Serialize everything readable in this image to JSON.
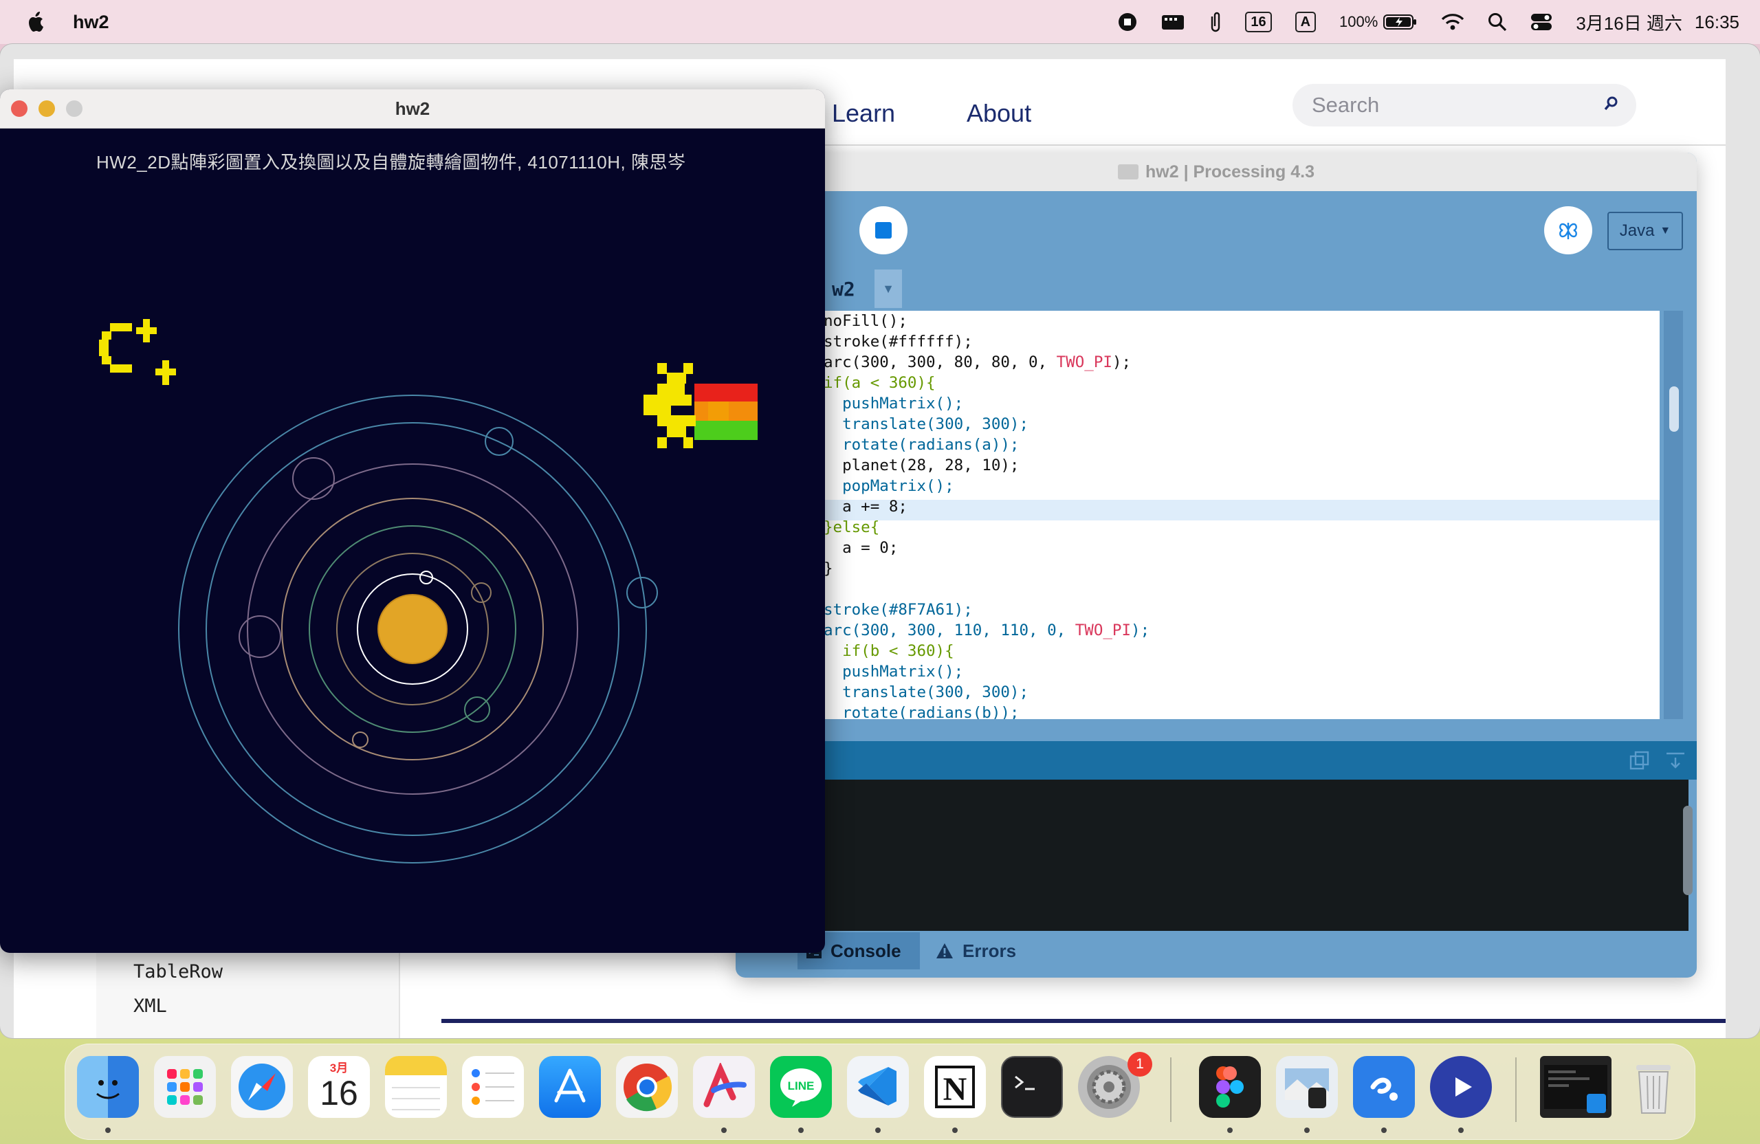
{
  "menubar": {
    "app_name": "hw2",
    "input_badge_16": "16",
    "input_badge_a": "A",
    "battery": "100%",
    "date": "3月16日 週六",
    "time": "16:35"
  },
  "browser": {
    "nav": {
      "learn": "Learn",
      "about": "About"
    },
    "search_placeholder": "Search",
    "reference_items": [
      "TableRow",
      "XML"
    ]
  },
  "ide": {
    "title": "hw2 | Processing 4.3",
    "mode": "Java",
    "tab": "w2",
    "code_lines": [
      "noFill();",
      "stroke(#ffffff);",
      "arc(300, 300, 80, 80, 0, TWO_PI);",
      "if(a < 360){",
      "  pushMatrix();",
      "  translate(300, 300);",
      "  rotate(radians(a));",
      "  planet(28, 28, 10);",
      "  popMatrix();",
      "  a += 8;",
      "}else{",
      "  a = 0;",
      "}",
      "",
      "stroke(#8F7A61);",
      "arc(300, 300, 110, 110, 0, TWO_PI);",
      "  if(b < 360){",
      "  pushMatrix();",
      "  translate(300, 300);",
      "  rotate(radians(b));"
    ],
    "console_tab": "Console",
    "errors_tab": "Errors"
  },
  "sketch": {
    "window_title": "hw2",
    "heading": "HW2_2D點陣彩圖置入及換圖以及自體旋轉繪圖物件, 41071110H, 陳思岑"
  },
  "dock": {
    "calendar_month": "3月",
    "calendar_day": "16",
    "settings_badge": "1",
    "apps": [
      "finder-icon",
      "launchpad-icon",
      "safari-icon",
      "calendar-icon",
      "notes-icon",
      "reminders-icon",
      "app-store-icon",
      "chrome-icon",
      "sketchbook-icon",
      "line-icon",
      "vscode-icon",
      "notion-icon",
      "terminal-icon",
      "system-settings-icon",
      "figma-icon",
      "preview-icon",
      "processing-icon",
      "quicktime-icon",
      "screen-thumbnail-icon",
      "trash-icon"
    ]
  },
  "colors": {
    "sketch_bg": "#050527",
    "sun": "#e2a526",
    "ide_blue": "#6aa0cb",
    "console_bar": "#1a6fa3",
    "code_function": "#006699",
    "code_keyword": "#669900",
    "code_constant": "#d9375b"
  }
}
